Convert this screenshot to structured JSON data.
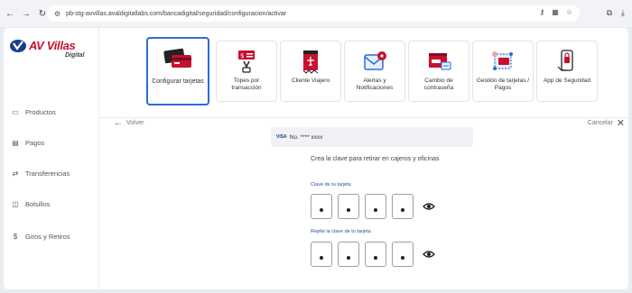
{
  "browser": {
    "url": "pb-stg-avvillas.avaldigitallabs.com/bancadigital/seguridad/configuracion/activar"
  },
  "brand": {
    "name": "AV Villas",
    "sub": "Digital",
    "accent": "#c8102e",
    "blue": "#1a3d8f"
  },
  "sidebar": {
    "items": [
      {
        "label": "Productos",
        "icon": "card-icon"
      },
      {
        "label": "Pagos",
        "icon": "bill-icon"
      },
      {
        "label": "Transferencias",
        "icon": "transfer-icon"
      },
      {
        "label": "Bolsillos",
        "icon": "pocket-icon"
      },
      {
        "label": "Giros y Retiros",
        "icon": "withdraw-icon"
      }
    ]
  },
  "options": [
    {
      "label": "Configurar tarjetas",
      "icon": "cards-icon",
      "active": true
    },
    {
      "label": "Topes por transacción",
      "icon": "limits-icon",
      "active": false
    },
    {
      "label": "Cliente Viajero",
      "icon": "travel-icon",
      "active": false
    },
    {
      "label": "Alertas y Notificaciones",
      "icon": "alerts-icon",
      "active": false
    },
    {
      "label": "Cambio de contraseña",
      "icon": "password-icon",
      "active": false
    },
    {
      "label": "Gestión de tarjetas / Pagos",
      "icon": "card-management-icon",
      "active": false
    },
    {
      "label": "App de Seguridad",
      "icon": "security-app-icon",
      "active": false
    }
  ],
  "main": {
    "back_label": "Volver",
    "cancel_label": "Cancelar",
    "card_brand": "VISA",
    "card_number": "No. **** xxxx",
    "instruction": "Crea la clave para retirar en cajeros y oficinas",
    "pin_label": "Clave de tu tarjeta",
    "confirm_label": "Repite la clave de tu tarjeta"
  }
}
